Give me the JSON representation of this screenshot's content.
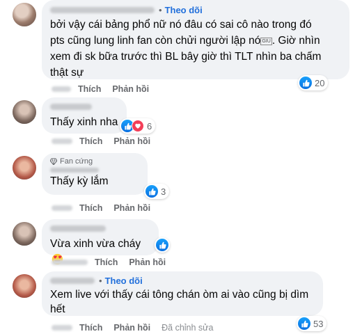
{
  "labels": {
    "follow": "Theo dõi",
    "like": "Thích",
    "reply": "Phản hồi",
    "edited": "Đã chỉnh sửa",
    "fan_badge": "Fan cứng"
  },
  "comments": [
    {
      "text": "bởi vậy cái bảng phổ nữ nó đâu có sai cô nào trong đó pts cũng lung linh fan còn chửi người lập nó… Giờ nhìn xem đi sk bữa trước thì BL bây giờ thì TLT nhìn ba chấm thật sự",
      "lines": [
        "bởi vậy cái bảng phổ nữ nó đâu có sai cô nào trong đó",
        "pts cũng lung linh fan còn chửi người lập nó",
        "xem đi sk bữa trước thì BL bây giờ thì TLT nhìn ba chấm",
        "thật sự"
      ],
      "line2_tail": ". Giờ nhìn",
      "reactions": "20"
    },
    {
      "text": "Thấy xinh nha",
      "reactions": "6"
    },
    {
      "text": "Thấy kỳ lắm",
      "reactions": "3"
    },
    {
      "text": "Vừa xinh vừa cháy",
      "emoji": "heart-eyes-emoji"
    },
    {
      "lines": [
        "Xem live với thấy cái tông chán òm ai vào cũng bị dìm",
        "hết"
      ],
      "reactions": "53"
    }
  ],
  "colors": {
    "bubble": "#f0f2f5",
    "follow": "#216fdb",
    "meta": "#65676b",
    "like": "#1877f2",
    "love": "#f33e58"
  }
}
